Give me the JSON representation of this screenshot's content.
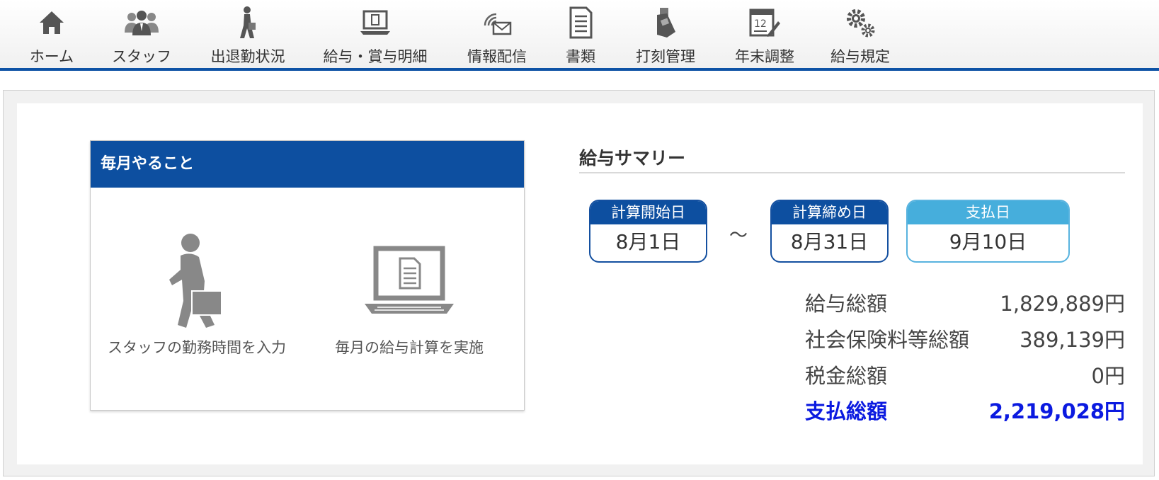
{
  "nav": {
    "home": "ホーム",
    "staff": "スタッフ",
    "attendance": "出退勤状況",
    "payslip": "給与・賞与明細",
    "broadcast": "情報配信",
    "documents": "書類",
    "timeclock": "打刻管理",
    "yearend": "年末調整",
    "payrules": "給与規定",
    "calendar_number": "12"
  },
  "monthly": {
    "title": "毎月やること",
    "task1_label": "スタッフの勤務時間を入力",
    "task2_label": "毎月の給与計算を実施"
  },
  "summary": {
    "title": "給与サマリー",
    "calc_start_label": "計算開始日",
    "calc_start_value": "8月1日",
    "tilde": "～",
    "calc_end_label": "計算締め日",
    "calc_end_value": "8月31日",
    "pay_label": "支払日",
    "pay_value": "9月10日",
    "rows": [
      {
        "label": "給与総額",
        "value": "1,829,889円"
      },
      {
        "label": "社会保険料等総額",
        "value": "389,139円"
      },
      {
        "label": "税金総額",
        "value": "0円"
      }
    ],
    "total_label": "支払総額",
    "total_value": "2,219,028円"
  },
  "colors": {
    "brand_blue": "#0d4fa0",
    "pay_blue": "#46aedc",
    "total_text": "#0b1ae0"
  }
}
